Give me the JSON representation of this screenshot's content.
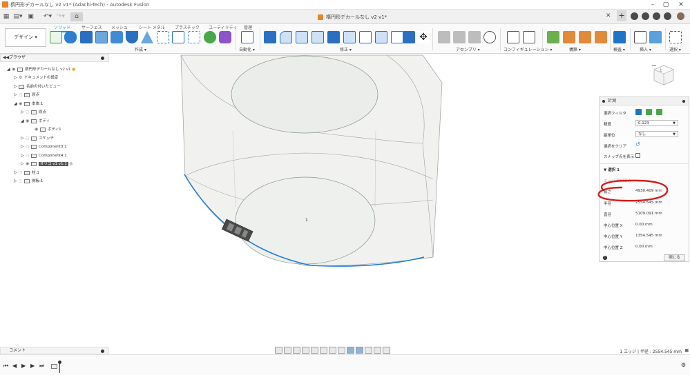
{
  "window": {
    "title": "楕円形デカールなし v2 v1* (Adachi-Tech) - Autodesk Fusion",
    "minimize": "–",
    "maximize": "▢",
    "close": "✕"
  },
  "tabbar": {
    "doc_tab_label": "楕円形デカールなし v2 v1*",
    "close_tab": "✕",
    "new_tab": "+"
  },
  "ribbon": {
    "workspace_label": "デザイン ▾",
    "tabs": [
      "ソリッド",
      "サーフェス",
      "メッシュ",
      "シート メタル",
      "プラスチック",
      "ユーティリティ",
      "管理"
    ],
    "groups": [
      "作成 ▾",
      "自動化 ▾",
      "修正 ▾",
      "アセンブリ ▾",
      "コンフィギュレーション ▾",
      "構築 ▾",
      "検査 ▾",
      "挿入 ▾",
      "選択 ▾"
    ]
  },
  "browser": {
    "header": "ブラウザ",
    "nodes": [
      {
        "label": "楕円形デカールなし v2 v1"
      },
      {
        "label": "ドキュメントの設定"
      },
      {
        "label": "名前の付いたビュー"
      },
      {
        "label": "原点"
      },
      {
        "label": "本体:1"
      },
      {
        "label": "原点"
      },
      {
        "label": "ボディ"
      },
      {
        "label": "ボディ1"
      },
      {
        "label": "スケッチ"
      },
      {
        "label": "Component3:1"
      },
      {
        "label": "Component4:1"
      },
      {
        "label": "オリゴ v1 v1:1"
      },
      {
        "label": "柱:1"
      },
      {
        "label": "側板:1"
      }
    ]
  },
  "comment_bar": {
    "label": "コメント"
  },
  "viewport": {
    "center_label": "1"
  },
  "viewcube": {
    "face_label": "上"
  },
  "inspect_panel": {
    "title": "計測",
    "filter_label": "選択フィルタ",
    "precision_label": "精度",
    "precision_value": "0.123",
    "unit_label": "副単位",
    "unit_value": "なし",
    "clear_label": "選択をクリア",
    "snap_label": "スナップ点を表示",
    "selection_header": "選択 1",
    "selection_type": "エッジ 選択済み",
    "rows": [
      {
        "label": "長さ",
        "value": "4930.409 mm"
      },
      {
        "label": "半径",
        "value": "2554.545 mm"
      },
      {
        "label": "直径",
        "value": "5109.091 mm"
      },
      {
        "label": "中心位置 X",
        "value": "0.00 mm"
      },
      {
        "label": "中心位置 Y",
        "value": "1354.545 mm"
      },
      {
        "label": "中心位置 Z",
        "value": "0.00 mm"
      }
    ],
    "close_label": "閉じる",
    "highlight_color": "#d91a1a"
  },
  "statusbar": {
    "right_text": "1 エッジ | 半径 : 2554.545 mm"
  },
  "colors": {
    "accent": "#0696d7",
    "brand_orange": "#e8842a",
    "edge_selected": "#1e7fd8"
  }
}
